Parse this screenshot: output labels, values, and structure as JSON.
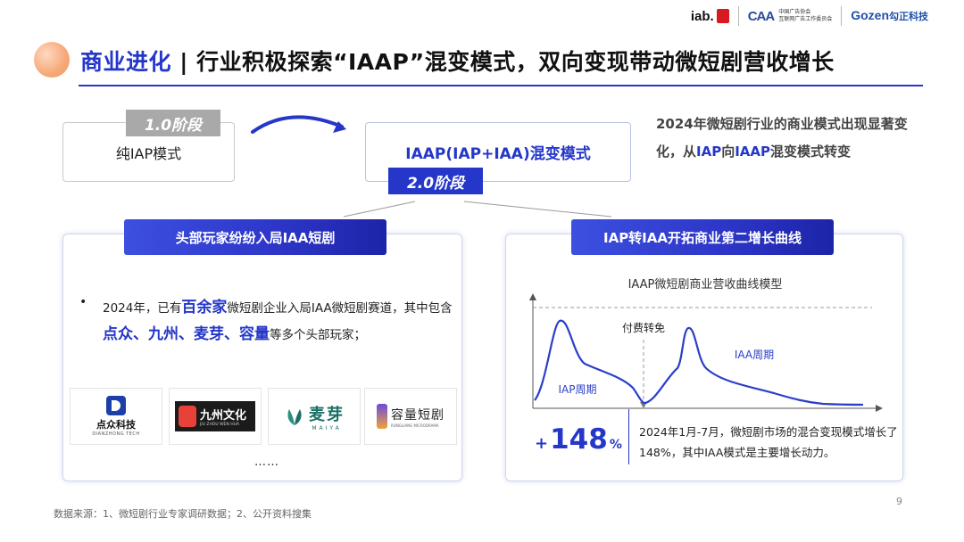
{
  "logos": {
    "iab": "iab.",
    "caa_mark": "CAA",
    "caa_line1": "中国广告协会",
    "caa_line2": "互联网广告工作委员会",
    "gozen": "Gozen",
    "gozen_cn": "勾正科技"
  },
  "title": {
    "accent": "商业进化",
    "separator": " | ",
    "main": "行业积极探索“IAAP”混变模式，双向变现带动微短剧营收增长"
  },
  "stages": {
    "stage1_label": "1.0阶段",
    "stage1_box": "纯IAP模式",
    "stage2_label": "2.0阶段",
    "stage2_box": "IAAP(IAP+IAA)混变模式"
  },
  "note": {
    "part1": "2024年微短剧行业的商业模式出现显著变化，从",
    "hl1": "IAP",
    "part2": "向",
    "hl2": "IAAP",
    "part3": "混变模式转变"
  },
  "left_card": {
    "tab": "头部玩家纷纷入局IAA短剧",
    "bullet": "•",
    "text1": "2024年，已有",
    "highlight1": "百余家",
    "text2": "微短剧企业入局IAA微短剧赛道，其中包含",
    "highlight2": "点众、九州、麦芽、容量",
    "text3": "等多个头部玩家；",
    "brands": {
      "dianzhong": {
        "name": "点众科技",
        "sub": "DIANZHONG TECH"
      },
      "jiuzhou": {
        "name": "九州文化",
        "sub": "JIU ZHOU WEN HUA"
      },
      "maiya": {
        "name": "麦芽",
        "sub": "MAIYA"
      },
      "rongliang": {
        "name": "容量短剧",
        "sub": "RONGLIANG MICRODRAMA"
      }
    },
    "ellipsis": "……"
  },
  "right_card": {
    "tab": "IAP转IAA开拓商业第二增长曲线",
    "chart_title": "IAAP微短剧商业营收曲线模型",
    "annotation_turn": "付费转免",
    "label_iap": "IAP周期",
    "label_iaa": "IAA周期",
    "growth_plus": "+",
    "growth_num": "148",
    "growth_pct": "%",
    "growth_text": "2024年1月-7月，微短剧市场的混合变现模式增长了148%，其中IAA模式是主要增长动力。"
  },
  "chart_data": {
    "type": "line",
    "title": "IAAP微短剧商业营收曲线模型",
    "xlabel": "",
    "ylabel": "",
    "series": [
      {
        "name": "IAP周期",
        "values": [
          0.05,
          0.9,
          0.6,
          0.45,
          0.35,
          0.2,
          0.0
        ]
      },
      {
        "name": "IAA周期",
        "values": [
          0.0,
          0.3,
          0.85,
          0.4,
          0.2,
          0.05,
          0.03
        ]
      }
    ],
    "annotations": [
      "付费转免"
    ],
    "axis_ticks": "none",
    "grid": false,
    "color": "#2a3fc9"
  },
  "footer": "数据来源：1、微短剧行业专家调研数据；2、公开资料搜集",
  "page_number": "9"
}
